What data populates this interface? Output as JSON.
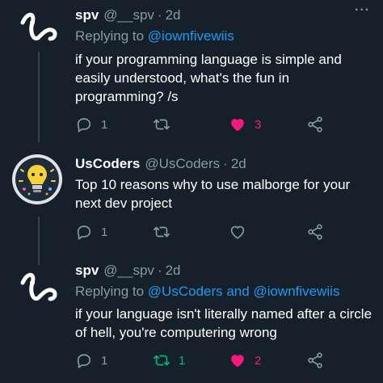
{
  "tweets": [
    {
      "name": "spv",
      "handle": "@__spv",
      "dot": "·",
      "time": "2d",
      "more": "···",
      "reply_prefix": "Replying to",
      "reply_target": "@iownfivewiis",
      "text": "if your programming language is simple and easily understood, what's the fun in programming? /s",
      "reply_count": "1",
      "retweet_count": "",
      "like_count": "3",
      "liked": true,
      "retweeted": false
    },
    {
      "name": "UsCoders",
      "handle": "@UsCoders",
      "dot": "·",
      "time": "2d",
      "text": "Top 10 reasons why to use malborge for your next dev project",
      "reply_count": "1",
      "retweet_count": "",
      "like_count": "",
      "liked": false,
      "retweeted": false
    },
    {
      "name": "spv",
      "handle": "@__spv",
      "dot": "·",
      "time": "2d",
      "reply_prefix": "Replying to",
      "reply_target": "@UsCoders and @iownfivewiis",
      "text": "if your language isn't literally named after a circle of hell, you're computering wrong",
      "reply_count": "1",
      "retweet_count": "1",
      "like_count": "2",
      "liked": true,
      "retweeted": true
    }
  ],
  "icons": {
    "reply": "reply-icon",
    "retweet": "retweet-icon",
    "like": "heart-icon",
    "share": "share-icon"
  },
  "colors": {
    "background": "#15202b",
    "secondary_text": "#8b98a5",
    "link": "#1d9bf0",
    "like_active": "#f91880",
    "retweet_active": "#00ba7c",
    "thread_line": "#38444d"
  }
}
